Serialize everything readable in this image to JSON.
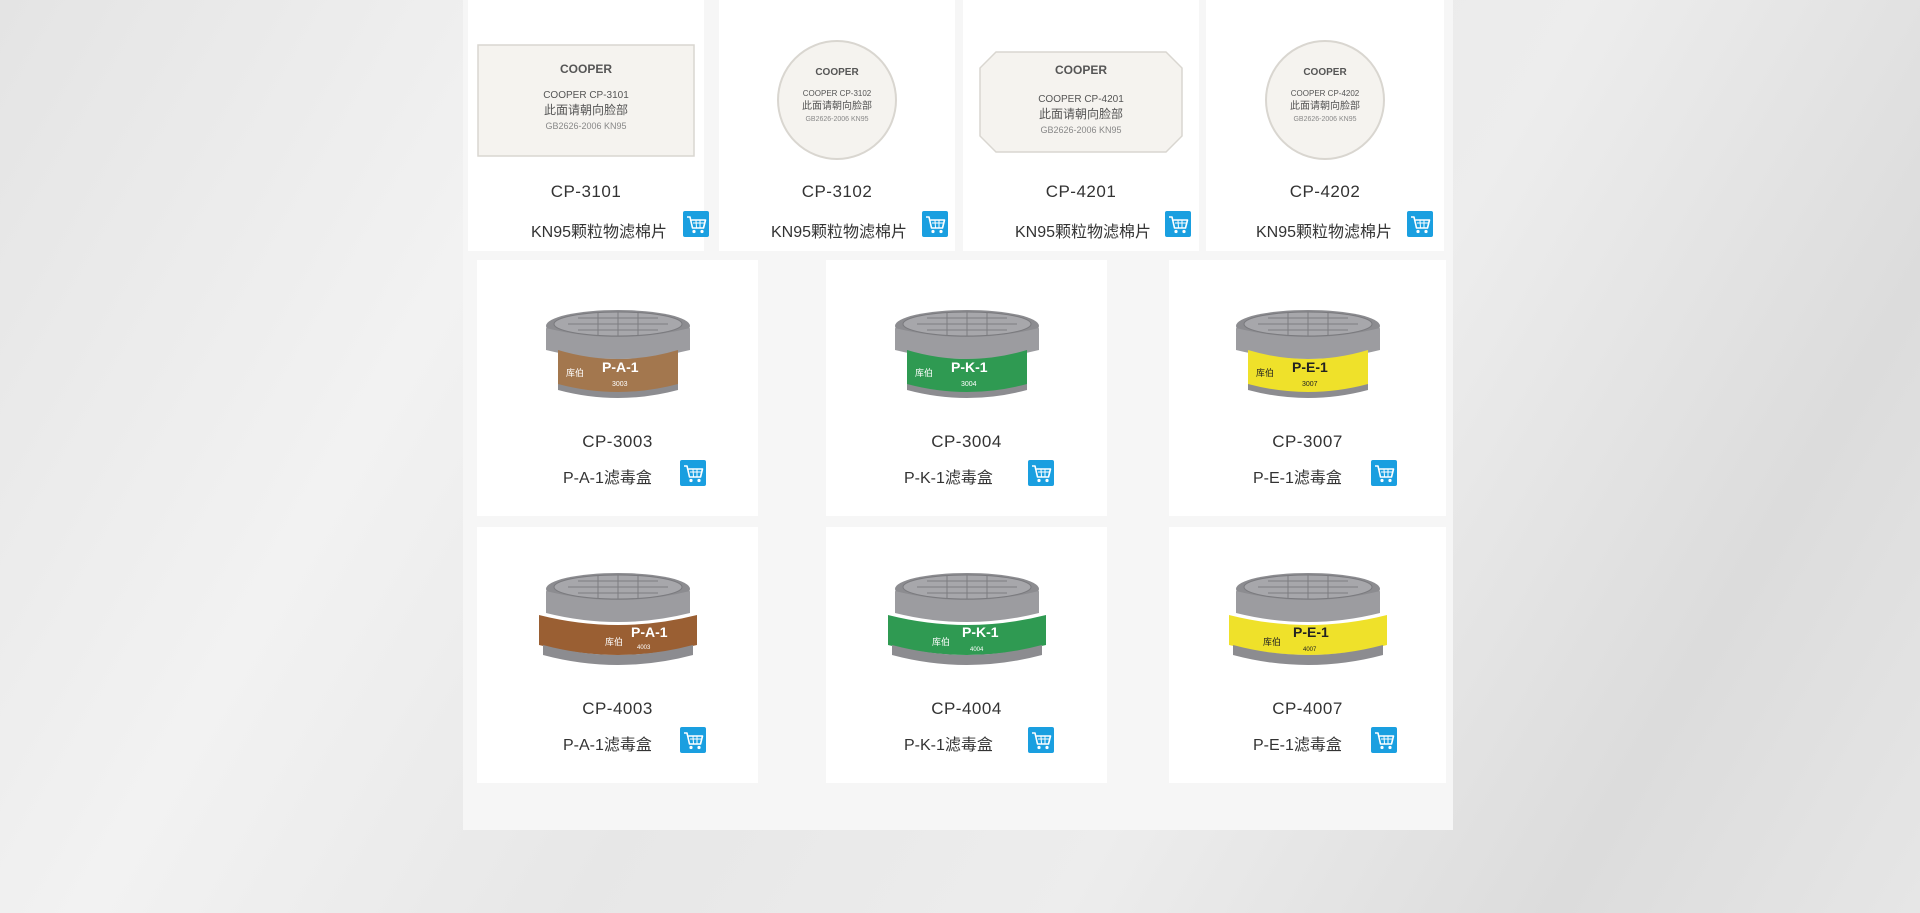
{
  "products_row1": [
    {
      "code": "CP-3101",
      "desc": "KN95颗粒物滤棉片",
      "img_brand": "COOPER",
      "img_line1": "COOPER  CP-3101",
      "img_line2": "此面请朝向脸部",
      "img_line3": "GB2626-2006  KN95",
      "cart_icon": "shopping-cart-icon"
    },
    {
      "code": "CP-3102",
      "desc": "KN95颗粒物滤棉片",
      "img_brand": "COOPER",
      "img_line1": "COOPER  CP-3102",
      "img_line2": "此面请朝向脸部",
      "img_line3": "GB2626-2006  KN95",
      "cart_icon": "shopping-cart-icon"
    },
    {
      "code": "CP-4201",
      "desc": "KN95颗粒物滤棉片",
      "img_brand": "COOPER",
      "img_line1": "COOPER  CP-4201",
      "img_line2": "此面请朝向脸部",
      "img_line3": "GB2626-2006  KN95",
      "cart_icon": "shopping-cart-icon"
    },
    {
      "code": "CP-4202",
      "desc": "KN95颗粒物滤棉片",
      "img_brand": "COOPER",
      "img_line1": "COOPER  CP-4202",
      "img_line2": "此面请朝向脸部",
      "img_line3": "GB2626-2006  KN95",
      "cart_icon": "shopping-cart-icon"
    }
  ],
  "products_row2": [
    {
      "code": "CP-3003",
      "desc": "P-A-1滤毒盒",
      "label": "P-A-1",
      "label_num": "3003",
      "brand_cn": "库伯",
      "label_color": "#a3774e",
      "cart_icon": "shopping-cart-icon"
    },
    {
      "code": "CP-3004",
      "desc": "P-K-1滤毒盒",
      "label": "P-K-1",
      "label_num": "3004",
      "brand_cn": "库伯",
      "label_color": "#2f9a52",
      "cart_icon": "shopping-cart-icon"
    },
    {
      "code": "CP-3007",
      "desc": "P-E-1滤毒盒",
      "label": "P-E-1",
      "label_num": "3007",
      "brand_cn": "库伯",
      "label_color": "#efe12a",
      "cart_icon": "shopping-cart-icon"
    }
  ],
  "products_row3": [
    {
      "code": "CP-4003",
      "desc": "P-A-1滤毒盒",
      "label": "P-A-1",
      "label_num": "4003",
      "brand_cn": "库伯",
      "label_color": "#9a5f33",
      "cart_icon": "shopping-cart-icon"
    },
    {
      "code": "CP-4004",
      "desc": "P-K-1滤毒盒",
      "label": "P-K-1",
      "label_num": "4004",
      "brand_cn": "库伯",
      "label_color": "#2f9a52",
      "cart_icon": "shopping-cart-icon"
    },
    {
      "code": "CP-4007",
      "desc": "P-E-1滤毒盒",
      "label": "P-E-1",
      "label_num": "4007",
      "brand_cn": "库伯",
      "label_color": "#efe12a",
      "cart_icon": "shopping-cart-icon"
    }
  ],
  "colors": {
    "accent_cart": "#1a9fe0",
    "text": "#333333",
    "card_bg": "#ffffff",
    "panel_bg": "#f6f6f6"
  }
}
